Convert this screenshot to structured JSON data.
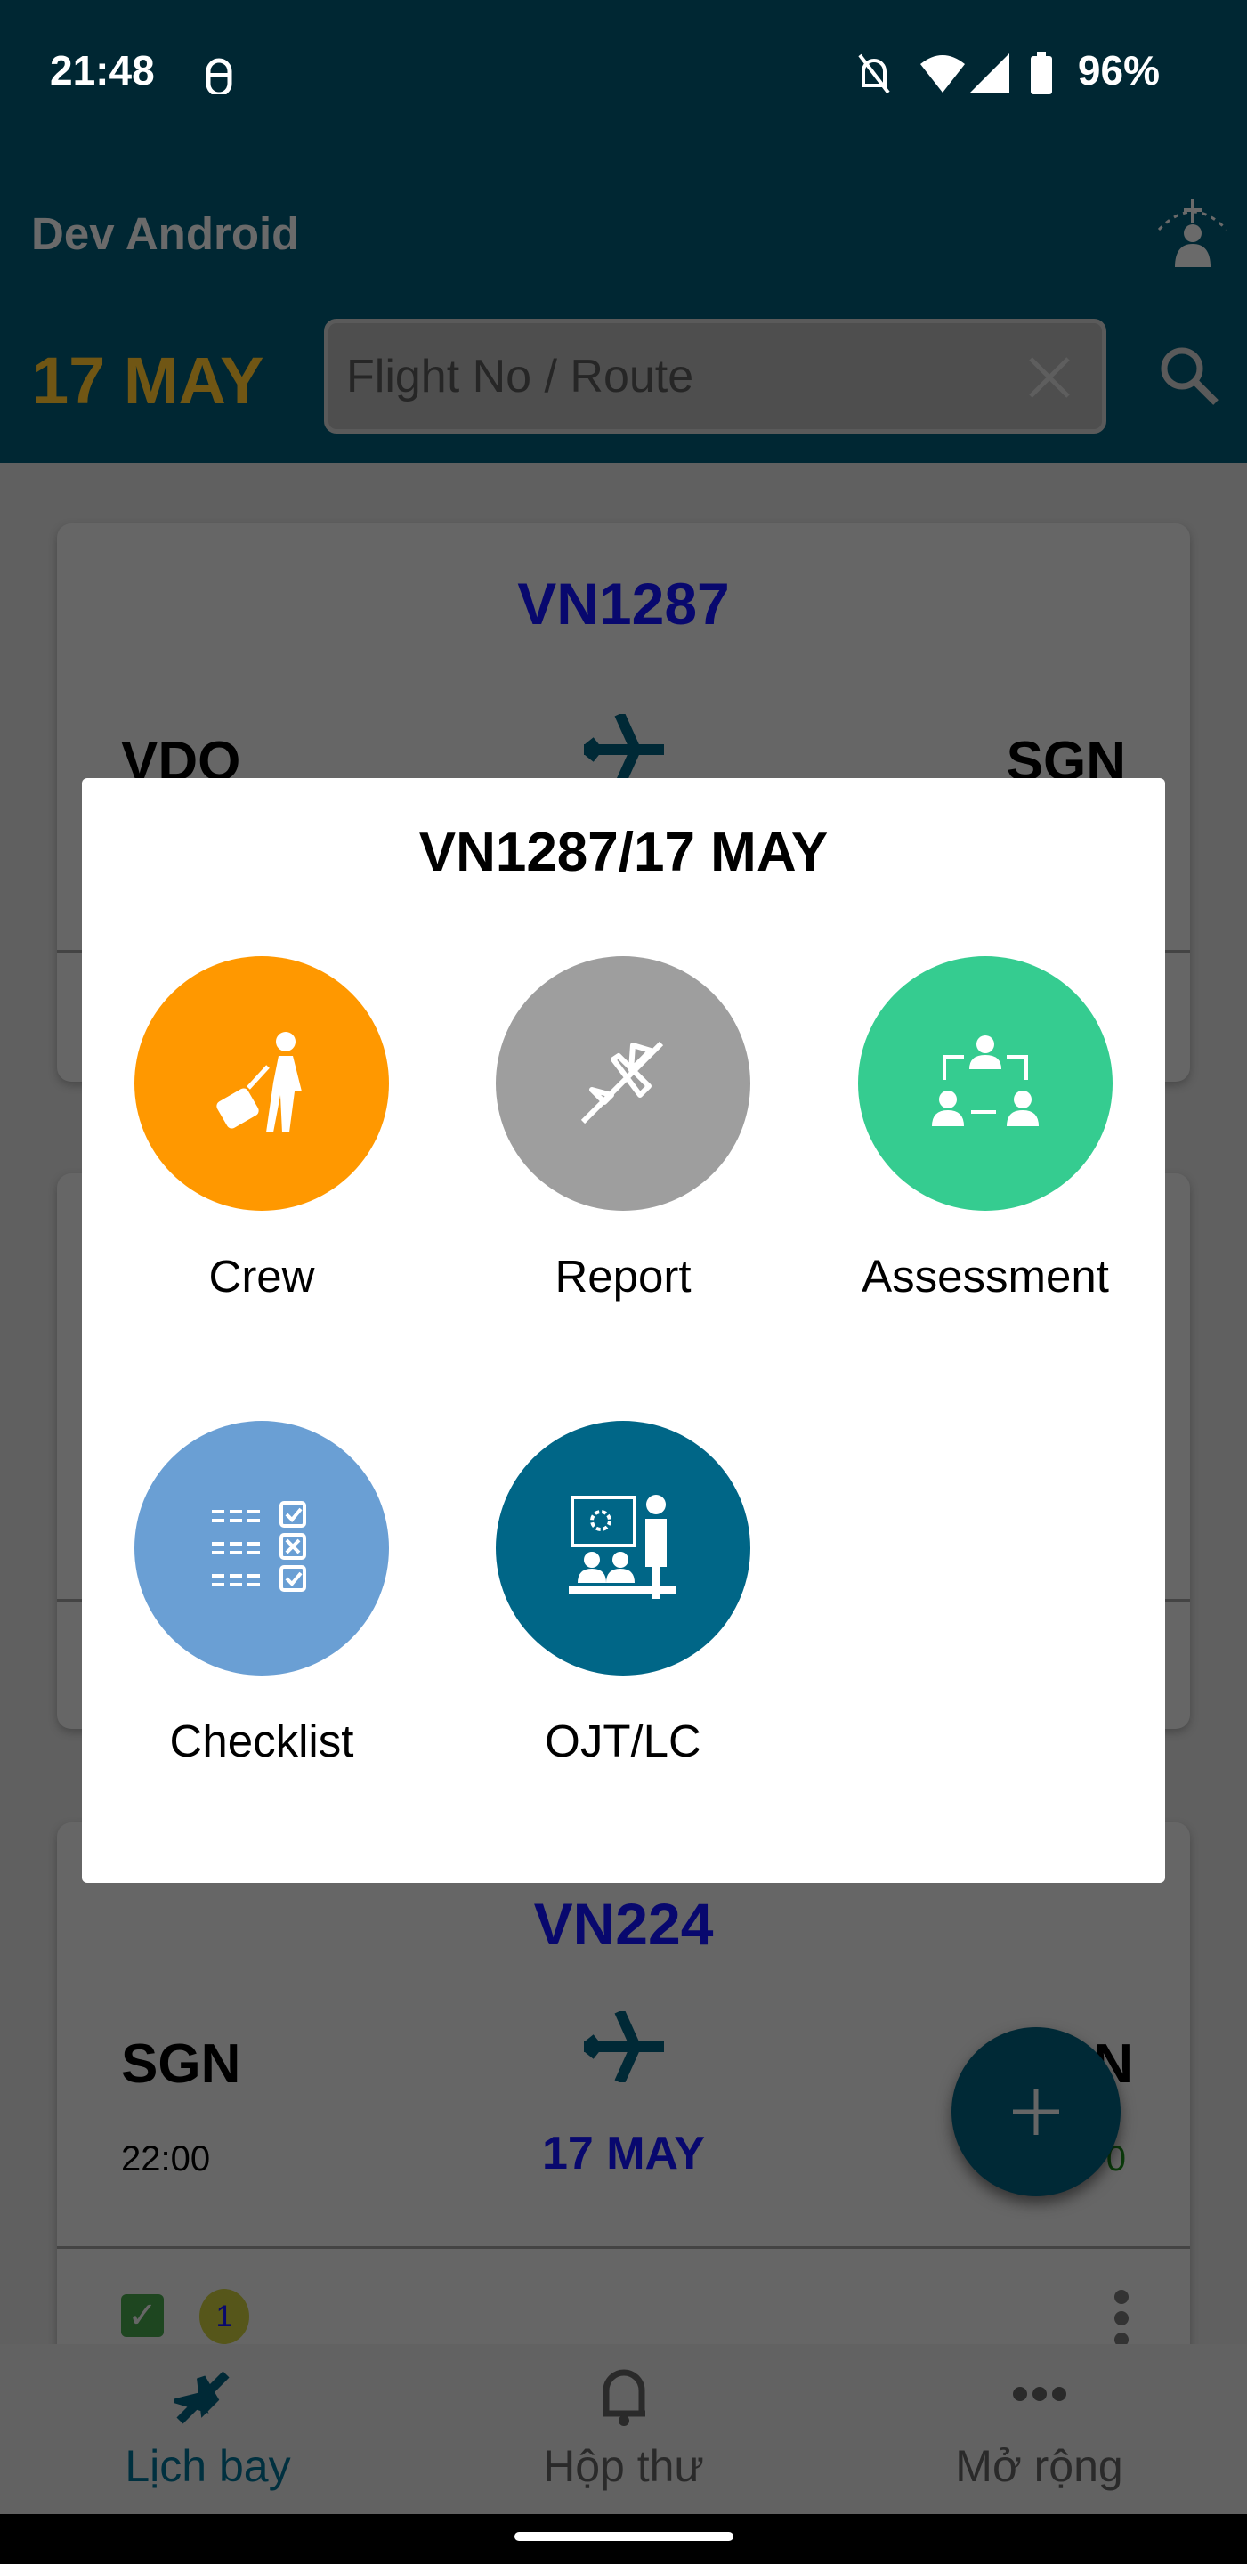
{
  "status_bar": {
    "time": "21:48",
    "battery": "96%",
    "icons": [
      "android-debug-icon",
      "bell-off-icon",
      "wifi-icon",
      "signal-icon",
      "battery-icon"
    ]
  },
  "header": {
    "title": "Dev Android",
    "date": "17 MAY",
    "search_placeholder": "Flight No / Route",
    "icons": [
      "profile-plane-icon",
      "clear-icon",
      "search-icon"
    ]
  },
  "flights": [
    {
      "flight_no": "VN1287",
      "from": "VDO",
      "to": "SGN"
    },
    {},
    {
      "flight_no": "VN224",
      "from": "SGN",
      "to": "N",
      "dep_time": "22:00",
      "arr_time": "0",
      "date": "17 MAY",
      "badge": "1"
    }
  ],
  "colors": {
    "header": "#00617f",
    "accent_date": "#ffcc2b",
    "flight_no": "#0a0aa0",
    "fab": "#006687"
  },
  "dialog": {
    "title": "VN1287/17 MAY",
    "options": [
      {
        "label": "Crew",
        "color": "#ff9800",
        "icon": "traveler-luggage-icon"
      },
      {
        "label": "Report",
        "color": "#9e9e9e",
        "icon": "airplane-icon"
      },
      {
        "label": "Assessment",
        "color": "#35cc90",
        "icon": "people-exchange-icon"
      },
      {
        "label": "Checklist",
        "color": "#6a9fd4",
        "icon": "checklist-icon"
      },
      {
        "label": "OJT/LC",
        "color": "#006687",
        "icon": "trainer-presentation-icon"
      }
    ]
  },
  "fab": {
    "icon": "plus-icon"
  },
  "bottom_nav": [
    {
      "label": "Lịch bay",
      "icon": "airplane-icon",
      "active": true
    },
    {
      "label": "Hộp thư",
      "icon": "bell-icon",
      "active": false
    },
    {
      "label": "Mở rộng",
      "icon": "more-horizontal-icon",
      "active": false
    }
  ]
}
